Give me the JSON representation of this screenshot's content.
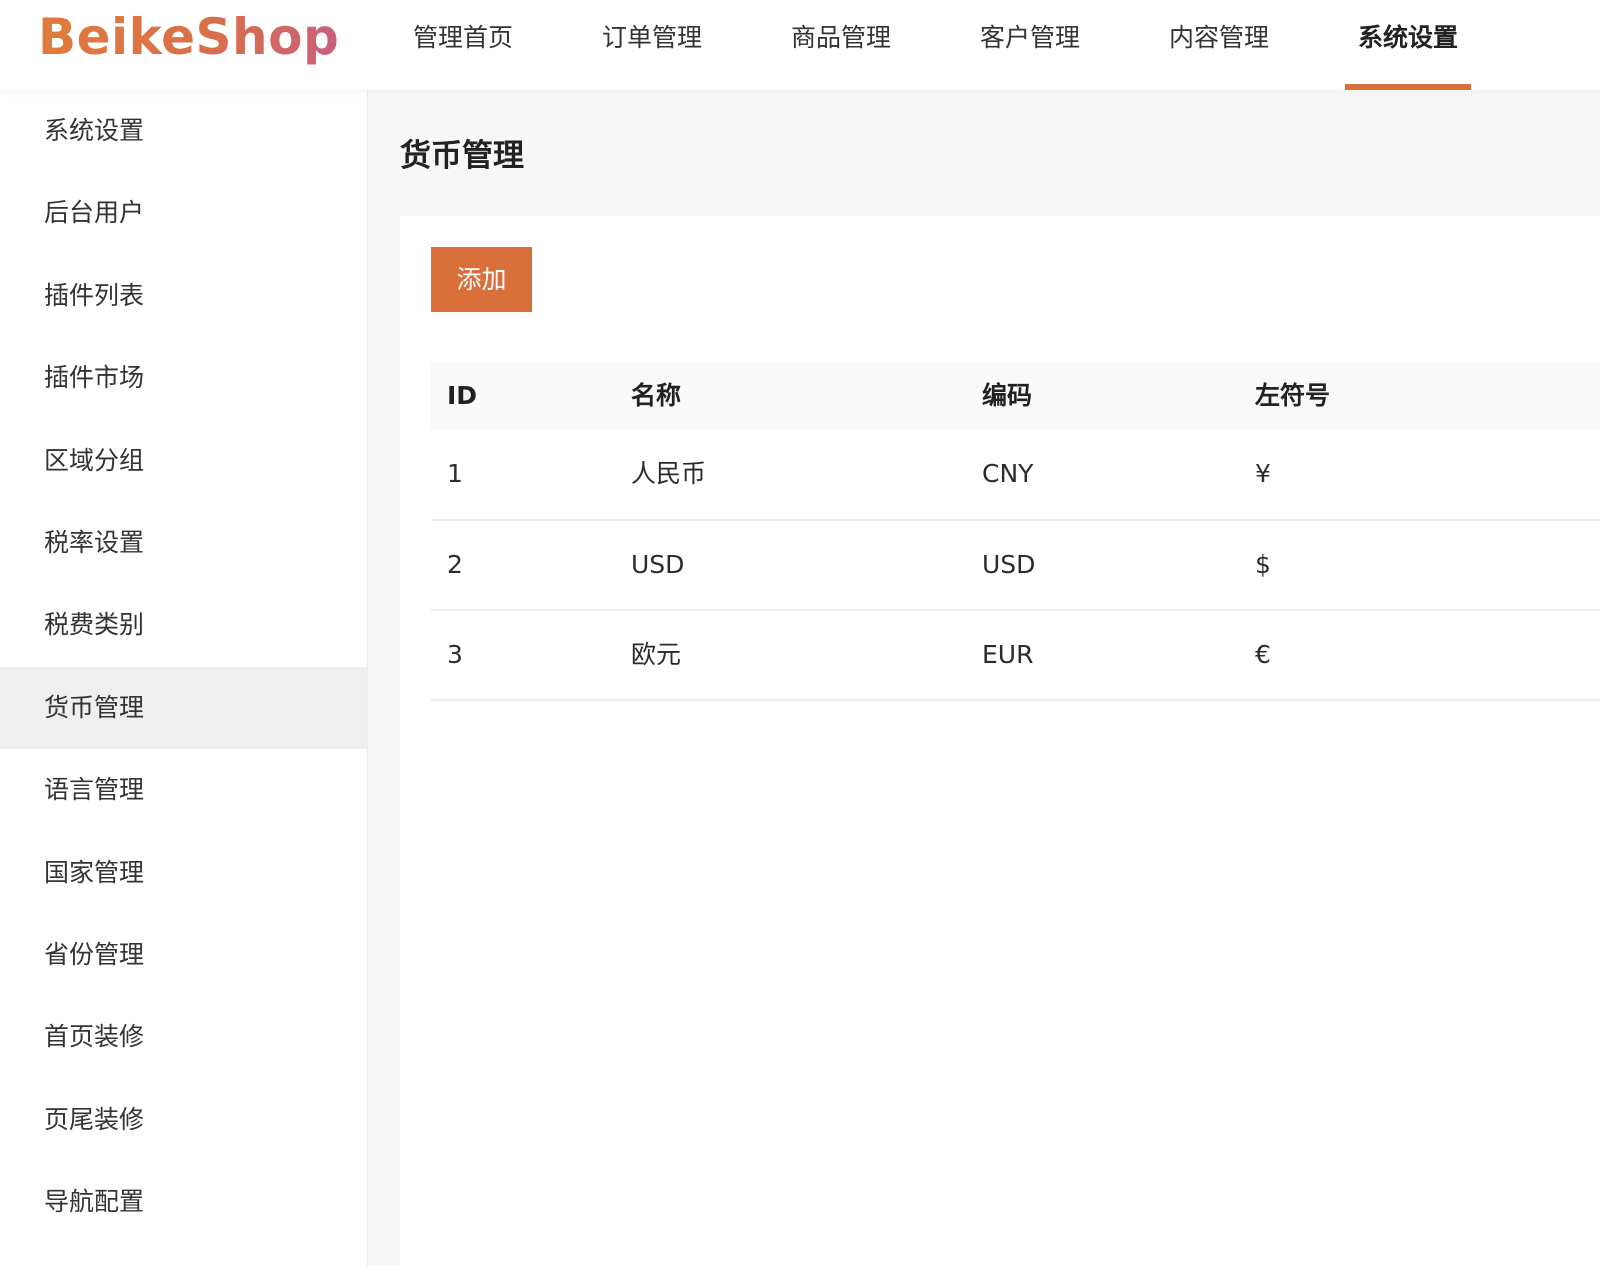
{
  "header": {
    "logo": "BeikeShop",
    "nav": [
      {
        "label": "管理首页"
      },
      {
        "label": "订单管理"
      },
      {
        "label": "商品管理"
      },
      {
        "label": "客户管理"
      },
      {
        "label": "内容管理"
      },
      {
        "label": "系统设置",
        "active": true
      }
    ]
  },
  "sidebar": {
    "items": [
      {
        "label": "系统设置"
      },
      {
        "label": "后台用户"
      },
      {
        "label": "插件列表"
      },
      {
        "label": "插件市场"
      },
      {
        "label": "区域分组"
      },
      {
        "label": "税率设置"
      },
      {
        "label": "税费类别"
      },
      {
        "label": "货币管理",
        "active": true
      },
      {
        "label": "语言管理"
      },
      {
        "label": "国家管理"
      },
      {
        "label": "省份管理"
      },
      {
        "label": "首页装修"
      },
      {
        "label": "页尾装修"
      },
      {
        "label": "导航配置"
      }
    ]
  },
  "main": {
    "title": "货币管理",
    "add_button": "添加",
    "table": {
      "headers": {
        "id": "ID",
        "name": "名称",
        "code": "编码",
        "left_symbol": "左符号"
      },
      "rows": [
        {
          "id": "1",
          "name": "人民币",
          "code": "CNY",
          "left_symbol": "¥"
        },
        {
          "id": "2",
          "name": "USD",
          "code": "USD",
          "left_symbol": "$"
        },
        {
          "id": "3",
          "name": "欧元",
          "code": "EUR",
          "left_symbol": "€"
        }
      ]
    }
  },
  "colors": {
    "accent": "#d9703a",
    "sidebar_active_bg": "#efefef",
    "main_bg": "#f7f7f7"
  }
}
